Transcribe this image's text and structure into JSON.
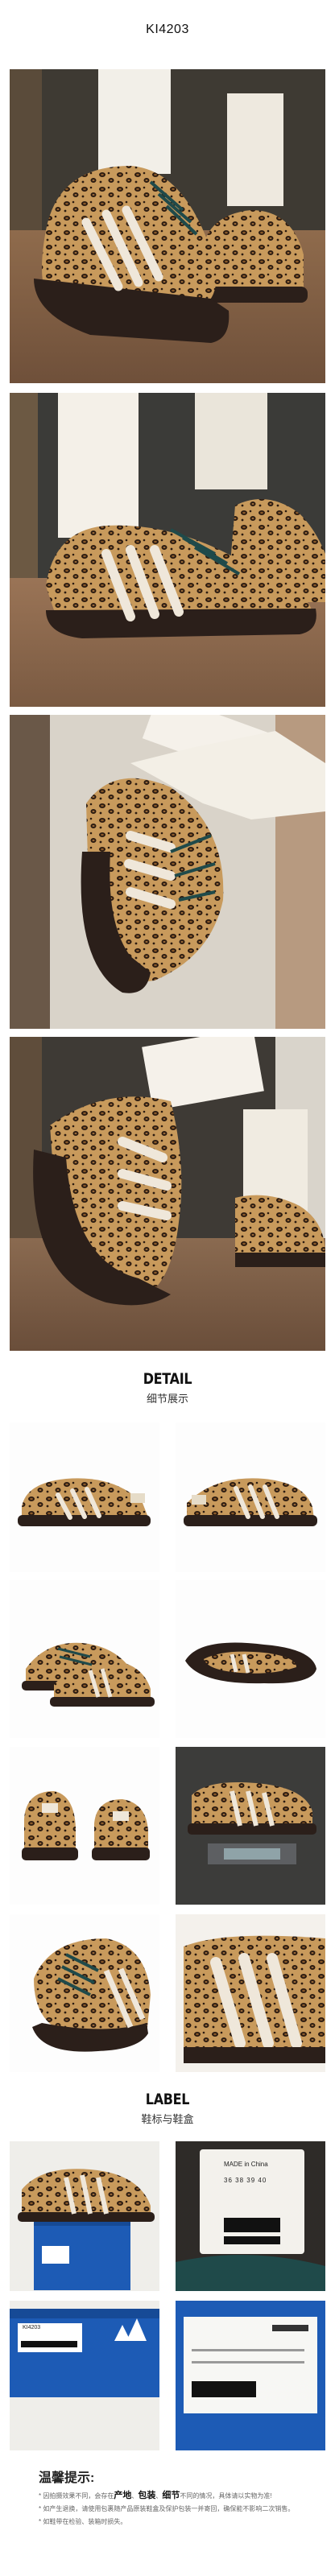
{
  "product_code": "KI4203",
  "detail_section": {
    "title_en": "DETAIL",
    "title_zh": "细节展示"
  },
  "label_section": {
    "title_en": "LABEL",
    "title_zh": "鞋标与鞋盒"
  },
  "box_label": {
    "made_in": "MADE in China",
    "sizes": "36  38  39  40",
    "box_code": "KI4203"
  },
  "tips": {
    "title": "温馨提示:",
    "line1_a": "* 因拍摄效果不同，会存在",
    "hl1": "产地",
    "sep1": "、",
    "hl2": "包装",
    "sep2": "、",
    "hl3": "细节",
    "line1_b": "不同的情况，具体请以实物为准!",
    "line2": "* 如产生退换，请使用包裹随产品原装鞋盒及保护包装一并寄回，确保能不影响二次销售。",
    "line3": "* 如鞋带在检验、装箱时损失。"
  },
  "colors": {
    "leopard_base": "#c89a5c",
    "leopard_spot": "#2a1a10",
    "sole_dark": "#2b1f1a",
    "stripe": "#efe7da",
    "lace": "#1f4a4a",
    "floor_wood": "#8a6748",
    "wall": "#3e3a33",
    "box_blue": "#1d5bb5"
  }
}
